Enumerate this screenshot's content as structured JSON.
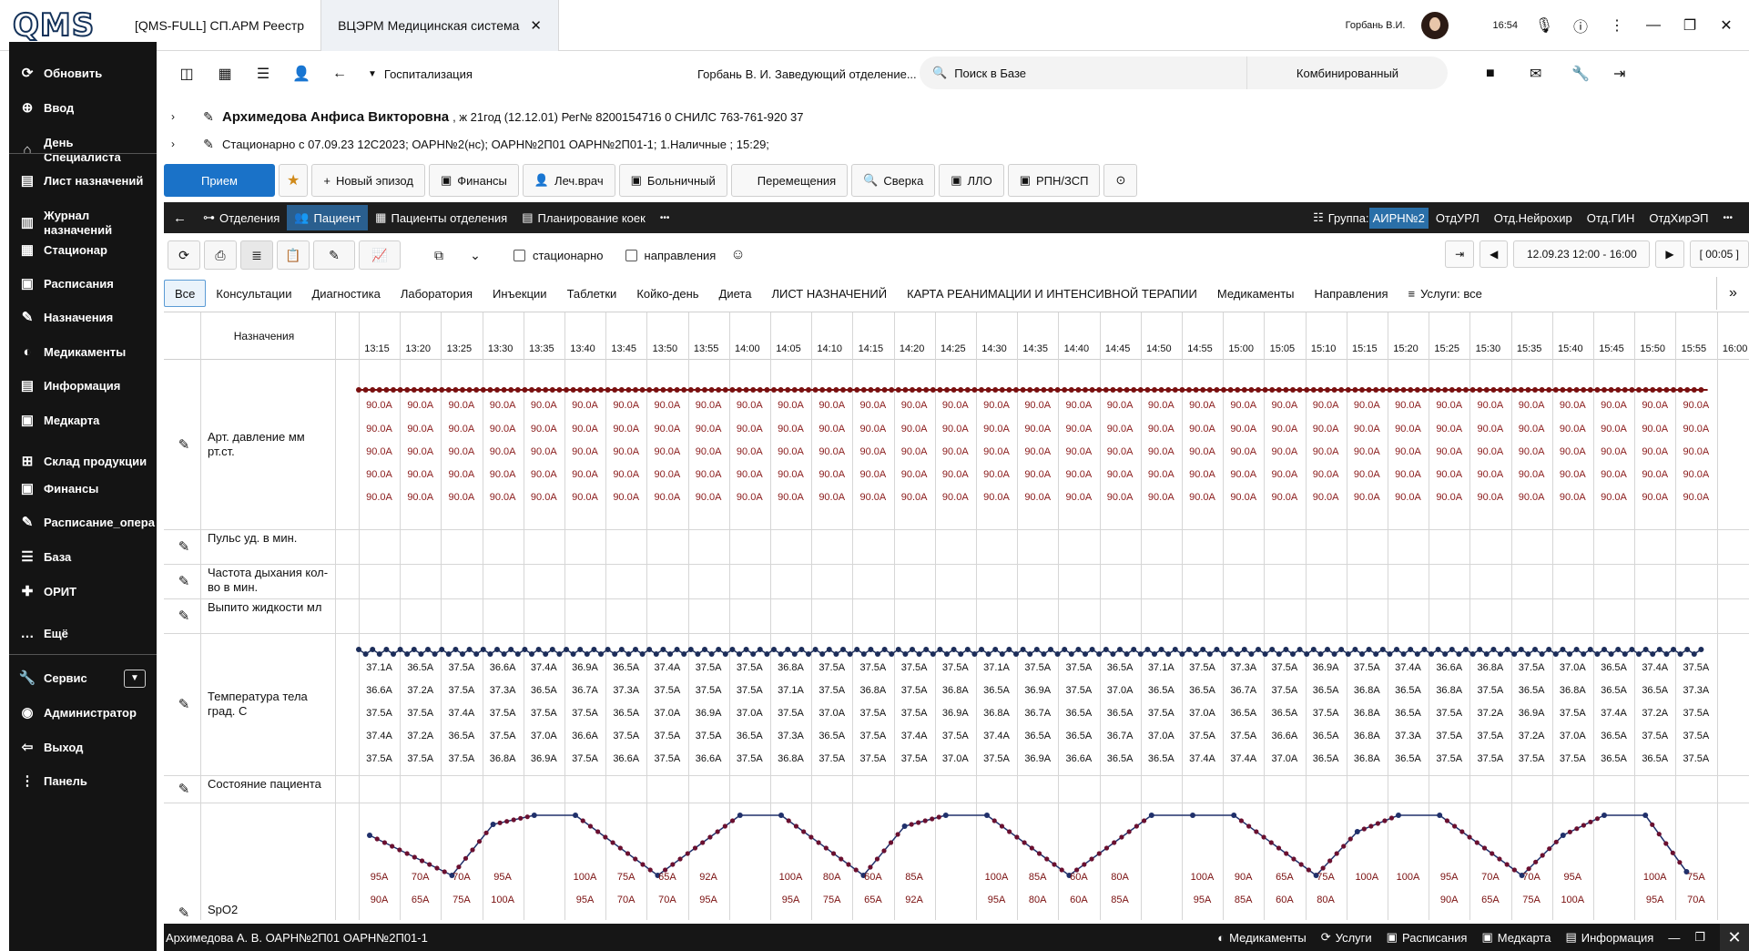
{
  "titlebar": {
    "logo": "QMS",
    "tabs": [
      {
        "label": "[QMS-FULL] СП.АРМ Реестр"
      },
      {
        "label": "ВЦЭРМ Медицинская система"
      }
    ],
    "user_name": "Горбань В.И.",
    "time": "16:54"
  },
  "sidebar": {
    "items": [
      {
        "label": "Обновить",
        "icon": "refresh-icon"
      },
      {
        "label": "Ввод",
        "icon": "add-user-icon"
      },
      {
        "label": "День Специалиста",
        "icon": "home-icon"
      },
      {
        "label": "Лист назначений",
        "icon": "list-icon"
      },
      {
        "label": "Журнал назначений",
        "icon": "journal-icon"
      },
      {
        "label": "Стационар",
        "icon": "hospital-icon"
      },
      {
        "label": "Расписания",
        "icon": "calendar-icon"
      },
      {
        "label": "Назначения",
        "icon": "prescription-icon"
      },
      {
        "label": "Медикаменты",
        "icon": "pills-icon"
      },
      {
        "label": "Информация",
        "icon": "info-icon"
      },
      {
        "label": "Медкарта",
        "icon": "medcard-icon"
      },
      {
        "label": "Склад продукции",
        "icon": "warehouse-icon"
      },
      {
        "label": "Финансы",
        "icon": "finance-icon"
      },
      {
        "label": "Расписание_опера",
        "icon": "schedule-icon"
      },
      {
        "label": "База",
        "icon": "database-icon"
      },
      {
        "label": "ОРИТ",
        "icon": "icu-icon"
      },
      {
        "label": "Ещё",
        "icon": "more-icon"
      },
      {
        "label": "Сервис",
        "icon": "wrench-icon"
      },
      {
        "label": "Администратор",
        "icon": "admin-icon"
      },
      {
        "label": "Выход",
        "icon": "exit-icon"
      },
      {
        "label": "Панель",
        "icon": "panel-icon"
      }
    ]
  },
  "header": {
    "section": "Госпитализация",
    "doctor": "Горбань В. И. Заведующий отделение...",
    "search_placeholder": "Поиск в Базе",
    "mode": "Комбинированный"
  },
  "patient": {
    "name": "Архимедова Анфиса Викторовна",
    "details": ", ж 21год (12.12.01) Рег№ 8200154716 0 СНИЛС 763-761-920 37",
    "stay": "Стационарно с 07.09.23  12С2023; ОАРН№2(нс); ОАРН№2П01 ОАРН№2П01-1;  1.Наличные ; 15:29;"
  },
  "buttons": {
    "primary": "Прием",
    "items": [
      "Новый эпизод",
      "Финансы",
      "Леч.врач",
      "Больничный",
      "Перемещения",
      "Сверка",
      "ЛЛО",
      "РПН/ЗСП"
    ]
  },
  "navbar": {
    "items": [
      "Отделения",
      "Пациент",
      "Пациенты отделения",
      "Планирование коек"
    ],
    "group_label": "Группа:",
    "group_value": "АИРН№2",
    "right_items": [
      "ОтдУРЛ",
      "Отд.Нейрохир",
      "Отд.ГИН",
      "ОтдХирЭП"
    ]
  },
  "toolbar": {
    "chk_stationary": "стационарно",
    "chk_directions": "направления",
    "date_range": "12.09.23 12:00 - 16:00",
    "timer": "[ 00:05 ]"
  },
  "categories": {
    "items": [
      "Все",
      "Консультации",
      "Диагностика",
      "Лаборатория",
      "Инъекции",
      "Таблетки",
      "Койко-день",
      "Диета",
      "ЛИСТ НАЗНАЧЕНИЙ",
      "КАРТА РЕАНИМАЦИИ И ИНТЕНСИВНОЙ ТЕРАПИИ",
      "Медикаменты",
      "Направления"
    ],
    "services": "Услуги: все"
  },
  "grid": {
    "title": "Назначения",
    "times": [
      "13:15",
      "13:20",
      "13:25",
      "13:30",
      "13:35",
      "13:40",
      "13:45",
      "13:50",
      "13:55",
      "14:00",
      "14:05",
      "14:10",
      "14:15",
      "14:20",
      "14:25",
      "14:30",
      "14:35",
      "14:40",
      "14:45",
      "14:50",
      "14:55",
      "15:00",
      "15:05",
      "15:10",
      "15:15",
      "15:20",
      "15:25",
      "15:30",
      "15:35",
      "15:40",
      "15:45",
      "15:50",
      "15:55",
      "16:00"
    ],
    "row_labels": {
      "bp": "Арт. давление мм рт.ст.",
      "pulse": "Пульс уд. в мин.",
      "resp": "Частота дыхания кол-во в мин.",
      "fluid": "Выпито жидкости мл",
      "temp": "Температура тела град. С",
      "state": "Состояние пациента",
      "spo2": "SpO2"
    },
    "bp_value": "90.0A",
    "temp_rows": [
      [
        "37.1A",
        "36.5A",
        "37.5A",
        "36.6A",
        "37.4A",
        "36.9A",
        "36.5A",
        "37.4A",
        "37.5A",
        "37.5A",
        "36.8A",
        "37.5A",
        "37.5A",
        "37.5A",
        "37.5A",
        "37.1A",
        "37.5A",
        "37.5A",
        "36.5A",
        "37.1A",
        "37.5A",
        "37.3A",
        "37.5A",
        "36.9A",
        "37.5A",
        "37.4A",
        "36.6A",
        "36.8A",
        "37.5A",
        "37.0A",
        "36.5A",
        "37.4A",
        "37.5A"
      ],
      [
        "36.6A",
        "37.2A",
        "37.5A",
        "37.3A",
        "36.5A",
        "36.7A",
        "37.3A",
        "37.5A",
        "37.5A",
        "37.5A",
        "37.1A",
        "37.5A",
        "36.8A",
        "37.5A",
        "36.8A",
        "36.5A",
        "36.9A",
        "37.5A",
        "37.0A",
        "36.5A",
        "36.5A",
        "36.7A",
        "37.5A",
        "36.5A",
        "36.8A",
        "36.5A",
        "36.8A",
        "37.5A",
        "36.5A",
        "36.8A",
        "36.5A",
        "36.5A",
        "37.3A"
      ],
      [
        "37.5A",
        "37.5A",
        "37.4A",
        "37.5A",
        "37.5A",
        "37.5A",
        "36.5A",
        "37.0A",
        "36.9A",
        "37.0A",
        "37.5A",
        "37.0A",
        "37.5A",
        "37.5A",
        "36.9A",
        "36.8A",
        "36.7A",
        "36.5A",
        "36.5A",
        "37.5A",
        "37.0A",
        "36.5A",
        "36.5A",
        "37.5A",
        "36.8A",
        "36.5A",
        "37.5A",
        "37.2A",
        "36.9A",
        "37.5A",
        "37.4A",
        "37.2A",
        "37.5A"
      ],
      [
        "37.4A",
        "37.2A",
        "36.5A",
        "37.5A",
        "37.0A",
        "36.6A",
        "37.5A",
        "37.5A",
        "37.5A",
        "36.5A",
        "37.3A",
        "36.5A",
        "37.5A",
        "37.4A",
        "37.5A",
        "37.4A",
        "36.5A",
        "36.5A",
        "36.7A",
        "37.0A",
        "37.5A",
        "37.5A",
        "36.6A",
        "36.5A",
        "36.8A",
        "37.3A",
        "37.5A",
        "37.5A",
        "37.2A",
        "37.0A",
        "36.5A",
        "37.5A",
        "37.5A"
      ],
      [
        "37.5A",
        "37.5A",
        "37.5A",
        "36.8A",
        "36.9A",
        "37.5A",
        "36.6A",
        "37.5A",
        "36.6A",
        "37.5A",
        "36.8A",
        "37.5A",
        "37.5A",
        "37.5A",
        "37.0A",
        "37.5A",
        "36.9A",
        "36.6A",
        "36.5A",
        "36.5A",
        "37.4A",
        "37.4A",
        "37.0A",
        "36.5A",
        "36.8A",
        "36.5A",
        "37.5A",
        "37.5A",
        "37.5A",
        "37.5A",
        "36.5A",
        "36.5A",
        "37.5A"
      ]
    ],
    "spo2_row1": [
      "95A",
      "70A",
      "70A",
      "95A",
      "",
      "100A",
      "75A",
      "65A",
      "92A",
      "",
      "100A",
      "80A",
      "60A",
      "85A",
      "",
      "100A",
      "85A",
      "60A",
      "80A",
      "",
      "100A",
      "90A",
      "65A",
      "75A",
      "100A",
      "100A",
      "95A",
      "70A",
      "70A",
      "95A",
      "",
      "100A",
      "75A"
    ],
    "spo2_row2": [
      "90A",
      "65A",
      "75A",
      "100A",
      "",
      "95A",
      "70A",
      "70A",
      "95A",
      "",
      "95A",
      "75A",
      "65A",
      "92A",
      "",
      "95A",
      "80A",
      "60A",
      "85A",
      "",
      "95A",
      "85A",
      "60A",
      "80A",
      "",
      "",
      "90A",
      "65A",
      "75A",
      "100A",
      "",
      "95A",
      "70A"
    ]
  },
  "status": {
    "left": "Архимедова А. В. ОАРН№2П01 ОАРН№2П01-1",
    "items": [
      "Медикаменты",
      "Услуги",
      "Расписания",
      "Медкарта",
      "Информация"
    ]
  }
}
